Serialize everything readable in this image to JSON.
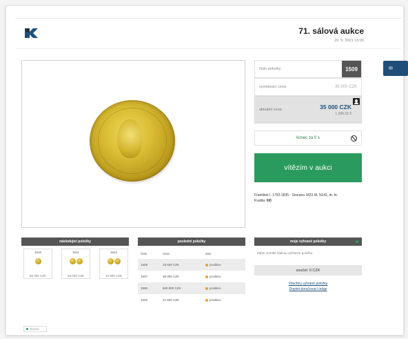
{
  "header": {
    "auction_title": "71. sálová aukce",
    "auction_date": "20. 5. 2021 13:00"
  },
  "side": {
    "lot_label": "číslo položky",
    "lot_number": "1509",
    "estimate_label": "vyvolávací cena",
    "estimate_value": "35 000 CZK",
    "current_label": "aktuální cena",
    "current_price": "35 000 CZK",
    "current_price_eur": "1 346.15 €",
    "end_text": "konec za 0 s",
    "win_button": "vítězím v aukci",
    "lot_description": "František I. 1792-1835 - Sovrano 1831 M, N141, dr. hr.",
    "quality_label": "Kvalita:",
    "quality_value": "0/0"
  },
  "mail_button": {
    "label": "✉"
  },
  "next_items": {
    "title": "následující položky",
    "items": [
      {
        "number": "1510",
        "price": "60 000 CZK"
      },
      {
        "number": "1511",
        "price": "25 000 CZK"
      },
      {
        "number": "1512",
        "price": "12 500 CZK"
      }
    ]
  },
  "last_items": {
    "title": "poslední položky",
    "headers": [
      "číslo",
      "cena",
      "stav"
    ],
    "rows": [
      {
        "number": "1508",
        "price": "15 500 CZK",
        "status": "prodáno"
      },
      {
        "number": "1507",
        "price": "38 000 CZK",
        "status": "prodáno"
      },
      {
        "number": "1506",
        "price": "500 000 CZK",
        "status": "prodáno"
      },
      {
        "number": "1505",
        "price": "21 500 CZK",
        "status": "prodáno"
      }
    ]
  },
  "won_items": {
    "title": "moje vyhrané položky",
    "empty_text": "Zatím nemáte žádnou vyhranou položku.",
    "sum": "součet: 0 CZK",
    "link_all": "Všechny vyhrané položky",
    "link_delivery": "Doplnit doručovací údaje"
  },
  "footer": {
    "tag": "dlouhá"
  }
}
